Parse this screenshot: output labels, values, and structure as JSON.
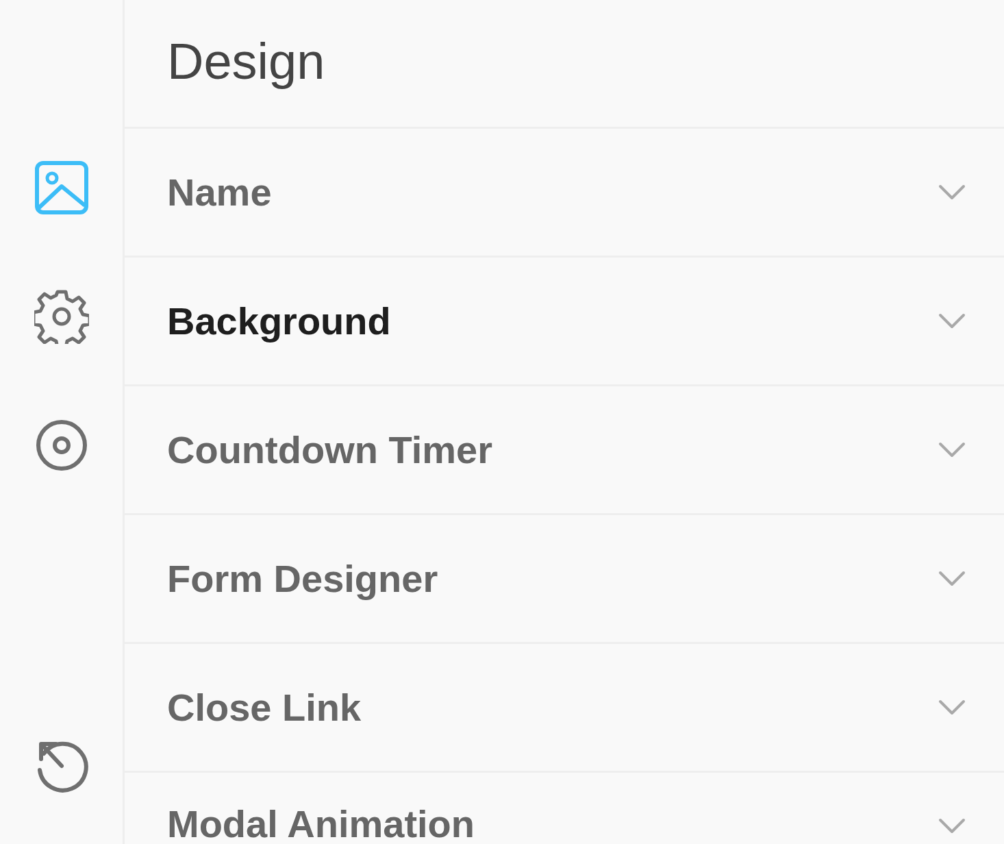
{
  "sidebar": {
    "items": [
      {
        "kind": "image",
        "selected": true
      },
      {
        "kind": "gear",
        "selected": false
      },
      {
        "kind": "target",
        "selected": false
      },
      {
        "kind": "history",
        "selected": false
      }
    ]
  },
  "panel": {
    "title": "Design",
    "sections": [
      {
        "label": "Name",
        "selected": false,
        "expanded": false
      },
      {
        "label": "Background",
        "selected": true,
        "expanded": false
      },
      {
        "label": "Countdown Timer",
        "selected": false,
        "expanded": false
      },
      {
        "label": "Form Designer",
        "selected": false,
        "expanded": false
      },
      {
        "label": "Close Link",
        "selected": false,
        "expanded": false
      },
      {
        "label": "Modal Animation",
        "selected": false,
        "expanded": false
      }
    ]
  }
}
